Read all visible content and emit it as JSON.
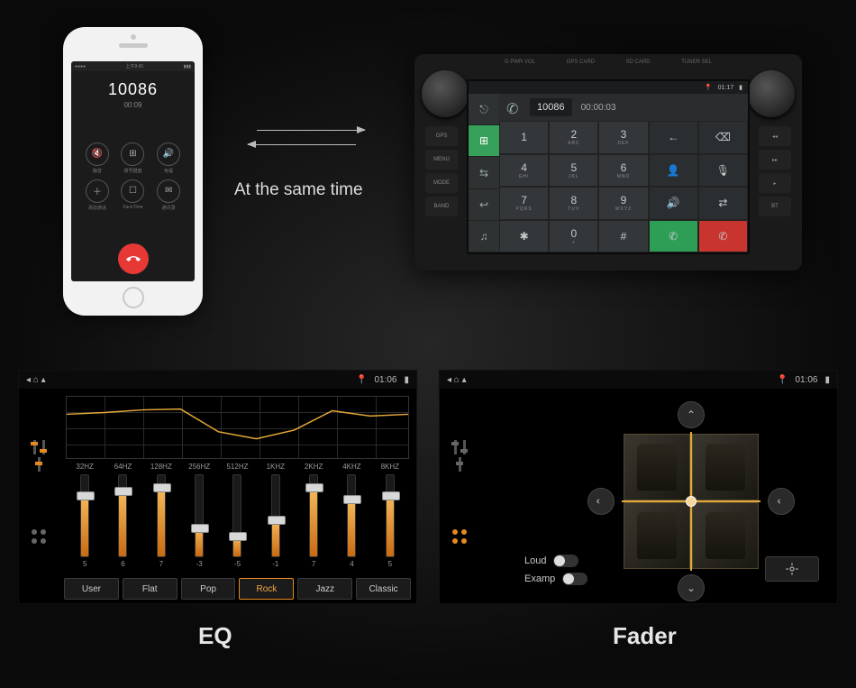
{
  "top": {
    "mid_text": "At the same time",
    "phone": {
      "status_left": "●●●●",
      "status_right": "▮▮▮",
      "number": "10086",
      "time": "00:09",
      "cells": [
        {
          "icon": "🔇",
          "label": "静音"
        },
        {
          "icon": "⊞",
          "label": "拨号键盘"
        },
        {
          "icon": "🔊",
          "label": "免提"
        },
        {
          "icon": "＋",
          "label": "添加通话"
        },
        {
          "icon": "☐",
          "label": "FaceTime"
        },
        {
          "icon": "✉",
          "label": "通讯录"
        }
      ]
    },
    "headunit": {
      "top_l": "G PWR VOL",
      "top_m": "GPS CARD",
      "top_r": "TUNER SEL",
      "side_l": [
        "GPS",
        "MENU",
        "MODE",
        "BAND"
      ],
      "side_r": [
        "◂◂",
        "▸▸",
        "▸",
        "BT"
      ],
      "status_time": "01:17",
      "left_icons": [
        "⎋",
        "⊞",
        "⇆",
        "↩",
        "♫"
      ],
      "display_number": "10086",
      "display_time": "00:00:03",
      "keys": [
        {
          "t": "1",
          "s": ""
        },
        {
          "t": "2",
          "s": "ABC"
        },
        {
          "t": "3",
          "s": "DEF"
        },
        {
          "t": "←",
          "s": "",
          "cls": "dark"
        },
        {
          "t": "⌫",
          "s": "",
          "cls": "dark"
        },
        {
          "t": "4",
          "s": "GHI"
        },
        {
          "t": "5",
          "s": "JKL"
        },
        {
          "t": "6",
          "s": "MNO"
        },
        {
          "t": "👤",
          "s": "",
          "cls": "dark"
        },
        {
          "t": "🎙",
          "s": "",
          "cls": "dark"
        },
        {
          "t": "7",
          "s": "PQRS"
        },
        {
          "t": "8",
          "s": "TUV"
        },
        {
          "t": "9",
          "s": "WXYZ"
        },
        {
          "t": "🔊",
          "s": "",
          "cls": "dark"
        },
        {
          "t": "⇄",
          "s": "",
          "cls": "dark"
        },
        {
          "t": "✱",
          "s": ""
        },
        {
          "t": "0",
          "s": "+"
        },
        {
          "t": "#",
          "s": ""
        },
        {
          "t": "✆",
          "s": "",
          "cls": "green"
        },
        {
          "t": "✆",
          "s": "",
          "cls": "red"
        }
      ]
    }
  },
  "panels": {
    "status_time": "01:06",
    "eq": {
      "caption": "EQ",
      "bands": [
        {
          "hz": "32HZ",
          "val": 5,
          "pct": 75
        },
        {
          "hz": "64HZ",
          "val": 6,
          "pct": 80
        },
        {
          "hz": "128HZ",
          "val": 7,
          "pct": 85
        },
        {
          "hz": "256HZ",
          "val": -3,
          "pct": 35
        },
        {
          "hz": "512HZ",
          "val": -5,
          "pct": 25
        },
        {
          "hz": "1KHZ",
          "val": -1,
          "pct": 45
        },
        {
          "hz": "2KHZ",
          "val": 7,
          "pct": 85
        },
        {
          "hz": "4KHZ",
          "val": 4,
          "pct": 70
        },
        {
          "hz": "8KHZ",
          "val": 5,
          "pct": 75
        }
      ],
      "presets": [
        "User",
        "Flat",
        "Pop",
        "Rock",
        "Jazz",
        "Classic"
      ],
      "active_preset": "Rock"
    },
    "fader": {
      "caption": "Fader",
      "loud": "Loud",
      "examp": "Examp"
    }
  }
}
